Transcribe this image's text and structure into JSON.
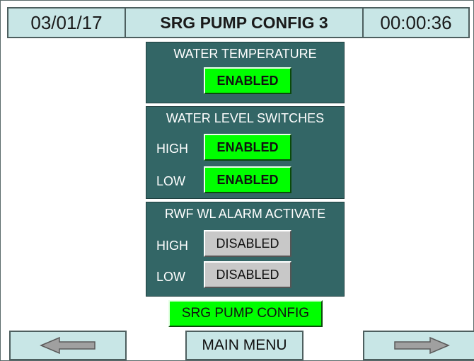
{
  "header": {
    "date": "03/01/17",
    "title": "SRG PUMP CONFIG 3",
    "time": "00:00:36"
  },
  "water_temperature": {
    "title": "WATER TEMPERATURE",
    "state": "ENABLED"
  },
  "water_level_switches": {
    "title": "WATER LEVEL SWITCHES",
    "high_label": "HIGH",
    "high_state": "ENABLED",
    "low_label": "LOW",
    "low_state": "ENABLED"
  },
  "rwf_wl_alarm": {
    "title": "RWF WL ALARM ACTIVATE",
    "high_label": "HIGH",
    "high_state": "DISABLED",
    "low_label": "LOW",
    "low_state": "DISABLED"
  },
  "footer": {
    "config_label": "SRG PUMP CONFIG",
    "main_menu_label": "MAIN MENU",
    "prev_icon": "left-arrow-icon",
    "next_icon": "right-arrow-icon"
  },
  "colors": {
    "header_bg": "#c8e6e6",
    "panel_bg": "#336666",
    "enabled": "#00ff00",
    "disabled": "#c8c8c8"
  }
}
